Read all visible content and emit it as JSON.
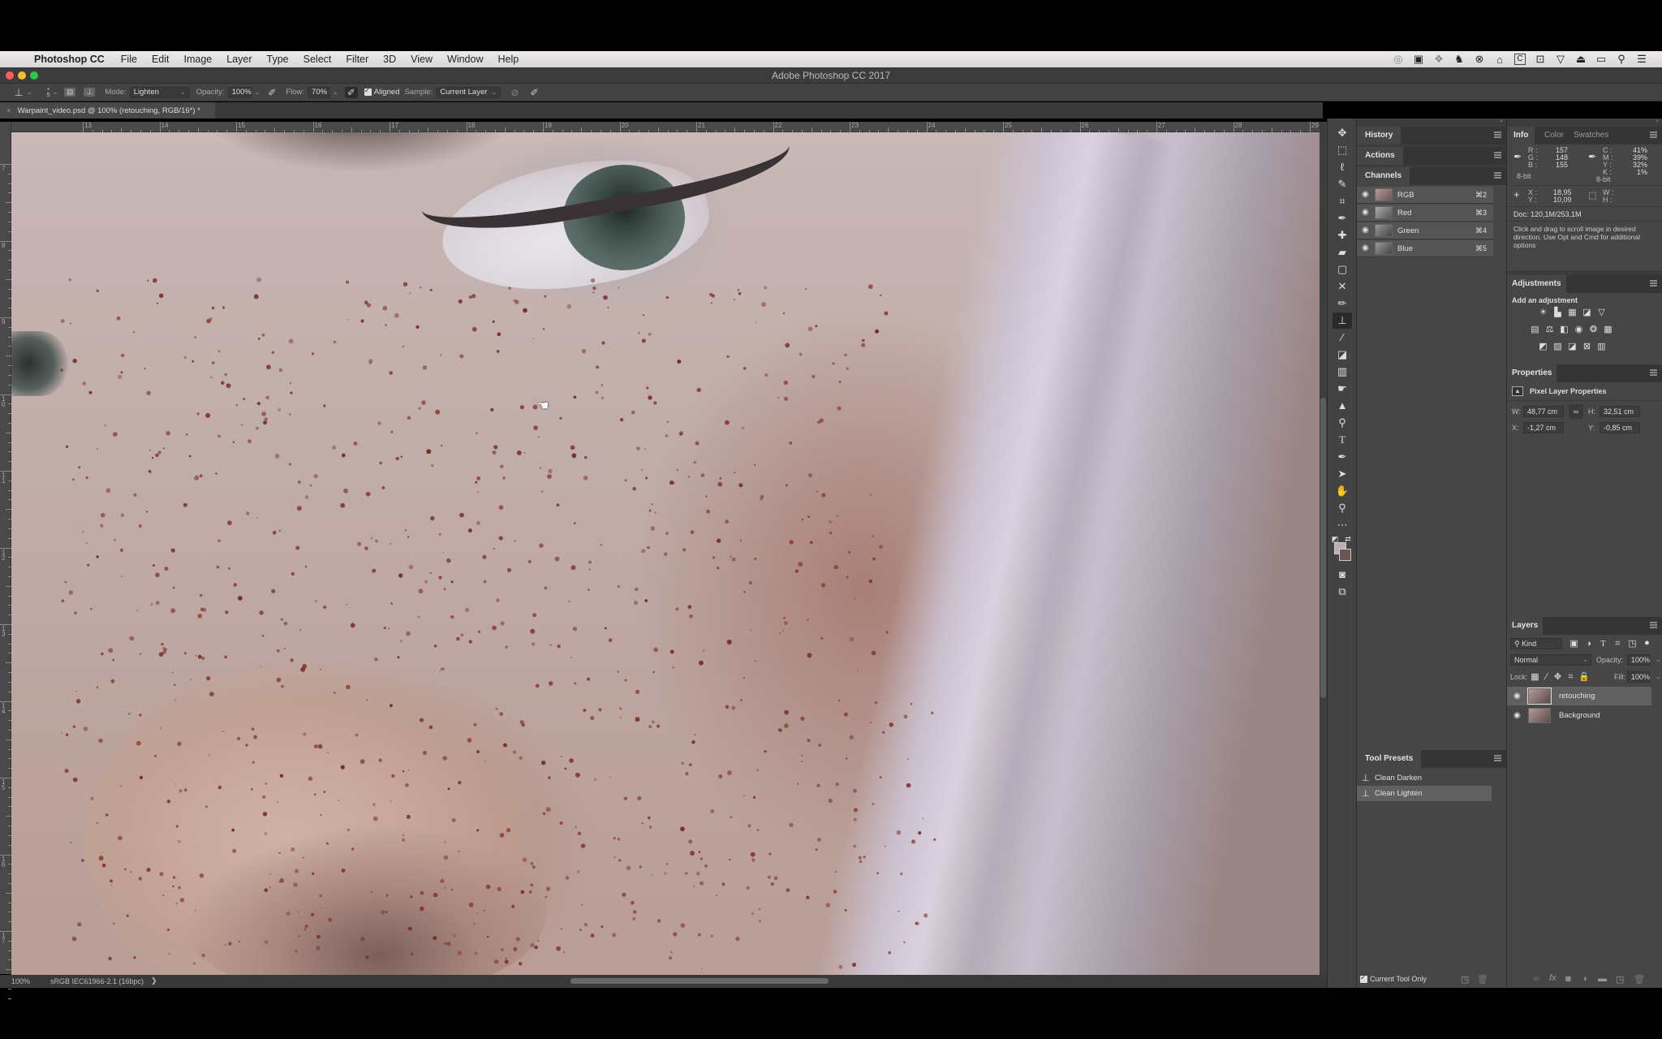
{
  "menubar": {
    "app_name": "Photoshop CC",
    "items": [
      "File",
      "Edit",
      "Image",
      "Layer",
      "Type",
      "Select",
      "Filter",
      "3D",
      "View",
      "Window",
      "Help"
    ],
    "status_icons": [
      "creative-cloud-icon",
      "display-icon",
      "dropbox-icon",
      "evernote-icon",
      "close-circle-icon",
      "home-icon",
      "c-icon",
      "camera-icon",
      "wifi-icon",
      "airplay-icon",
      "battery-icon",
      "spotlight-search-icon",
      "notification-list-icon"
    ]
  },
  "window": {
    "title": "Adobe Photoshop CC 2017"
  },
  "options_bar": {
    "brush_size": "5",
    "mode_label": "Mode:",
    "mode_value": "Lighten",
    "opacity_label": "Opacity:",
    "opacity_value": "100%",
    "flow_label": "Flow:",
    "flow_value": "70%",
    "aligned_label": "Aligned",
    "aligned_checked": true,
    "sample_label": "Sample:",
    "sample_value": "Current Layer"
  },
  "document": {
    "tab_title": "Warpaint_video.psd @ 100% (retouching, RGB/16*) *",
    "ruler_top": [
      "13",
      "14",
      "15",
      "16",
      "17",
      "18",
      "19",
      "20",
      "21",
      "22",
      "23",
      "24",
      "25",
      "26",
      "27",
      "28",
      "29"
    ],
    "ruler_left": [
      "7",
      "8",
      "9",
      "10",
      "11",
      "12",
      "13",
      "14",
      "15",
      "16",
      "17"
    ]
  },
  "status_bar": {
    "zoom": "100%",
    "profile": "sRGB IEC61966-2.1 (16bpc)",
    "arrow": "❯"
  },
  "panels": {
    "history": {
      "title": "History"
    },
    "actions": {
      "title": "Actions"
    },
    "channels": {
      "title": "Channels",
      "rows": [
        {
          "name": "RGB",
          "shortcut": "⌘2"
        },
        {
          "name": "Red",
          "shortcut": "⌘3"
        },
        {
          "name": "Green",
          "shortcut": "⌘4"
        },
        {
          "name": "Blue",
          "shortcut": "⌘5"
        }
      ]
    },
    "tool_presets": {
      "title": "Tool Presets",
      "items": [
        "Clean Darken",
        "Clean Lighten"
      ],
      "selected_index": 1,
      "current_tool_only_label": "Current Tool Only",
      "current_tool_only_checked": true
    },
    "info": {
      "tabs": [
        "Info",
        "Color",
        "Swatches"
      ],
      "rgb": {
        "R_label": "R :",
        "G_label": "G :",
        "B_label": "B :",
        "R": "157",
        "G": "148",
        "B": "155",
        "bits": "8-bit"
      },
      "cmyk": {
        "C_label": "C :",
        "M_label": "M :",
        "Y_label": "Y :",
        "K_label": "K :",
        "C": "41%",
        "M": "39%",
        "Y": "32%",
        "K": "1%",
        "bits": "8-bit"
      },
      "xy": {
        "X_label": "X :",
        "Y_label": "Y :",
        "X": "18,95",
        "Y": "10,09"
      },
      "wh": {
        "W_label": "W :",
        "H_label": "H :"
      },
      "doc": "Doc: 120,1M/253,1M",
      "hint": "Click and drag to scroll image in desired direction.  Use Opt and Cmd for additional options"
    },
    "adjustments": {
      "title": "Adjustments",
      "subtitle": "Add an adjustment",
      "row1": [
        "brightness-contrast-icon",
        "levels-icon",
        "curves-icon",
        "exposure-icon",
        "vibrance-icon"
      ],
      "row2": [
        "hue-saturation-icon",
        "color-balance-icon",
        "black-white-icon",
        "photo-filter-icon",
        "channel-mixer-icon",
        "color-lookup-icon"
      ],
      "row3": [
        "invert-icon",
        "posterize-icon",
        "threshold-icon",
        "selective-color-icon",
        "gradient-map-icon"
      ]
    },
    "properties": {
      "title": "Properties",
      "subtitle": "Pixel Layer Properties",
      "W_label": "W:",
      "W": "48,77 cm",
      "H_label": "H:",
      "H": "32,51 cm",
      "X_label": "X:",
      "X": "-1,27 cm",
      "Y_label": "Y:",
      "Y": "-0,85 cm"
    },
    "layers": {
      "title": "Layers",
      "filter_kind": "Kind",
      "blend_mode": "Normal",
      "opacity_label": "Opacity:",
      "opacity": "100%",
      "lock_label": "Lock:",
      "fill_label": "Fill:",
      "fill": "100%",
      "rows": [
        {
          "name": "retouching",
          "visible": true,
          "selected": true
        },
        {
          "name": "Background",
          "visible": true,
          "selected": false
        }
      ]
    }
  },
  "colors": {
    "foreground": "#bcaeb2",
    "background": "#6f5454",
    "traffic_red": "#fc5f57",
    "traffic_yellow": "#fdbc2e",
    "traffic_green": "#33c748"
  }
}
